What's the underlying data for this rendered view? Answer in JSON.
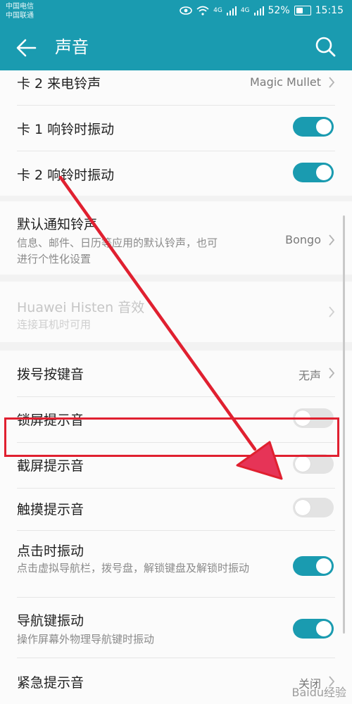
{
  "status": {
    "carrier1": "中国电信",
    "carrier2": "中国联通",
    "battery": "52%",
    "time": "15:15",
    "net_badge1": "4G",
    "net_badge2": "4G"
  },
  "header": {
    "title": "声音",
    "back_icon": "back-arrow-icon",
    "search_icon": "search-icon"
  },
  "colors": {
    "accent": "#1a9bb0",
    "highlight": "#e02030"
  },
  "items": [
    {
      "title": "卡 2 来电铃声",
      "value": "Magic Mullet"
    },
    {
      "title": "卡 1 响铃时振动",
      "toggle": "on"
    },
    {
      "title": "卡 2 响铃时振动",
      "toggle": "on"
    },
    {
      "title": "默认通知铃声",
      "subtitle": "信息、邮件、日历等应用的默认铃声，也可进行个性化设置",
      "value": "Bongo"
    },
    {
      "title": "Huawei Histen 音效",
      "subtitle": "连接耳机时可用",
      "disabled": true
    },
    {
      "title": "拨号按键音",
      "value": "无声"
    },
    {
      "title": "锁屏提示音",
      "toggle": "off"
    },
    {
      "title": "截屏提示音",
      "toggle": "off"
    },
    {
      "title": "触摸提示音",
      "toggle": "off"
    },
    {
      "title": "点击时振动",
      "subtitle": "点击虚拟导航栏，拨号盘，解锁键盘及解锁时振动",
      "toggle": "on"
    },
    {
      "title": "导航键振动",
      "subtitle": "操作屏幕外物理导航键时振动",
      "toggle": "on"
    },
    {
      "title": "紧急提示音",
      "value": "关闭"
    }
  ],
  "watermark": "Baidu经验"
}
